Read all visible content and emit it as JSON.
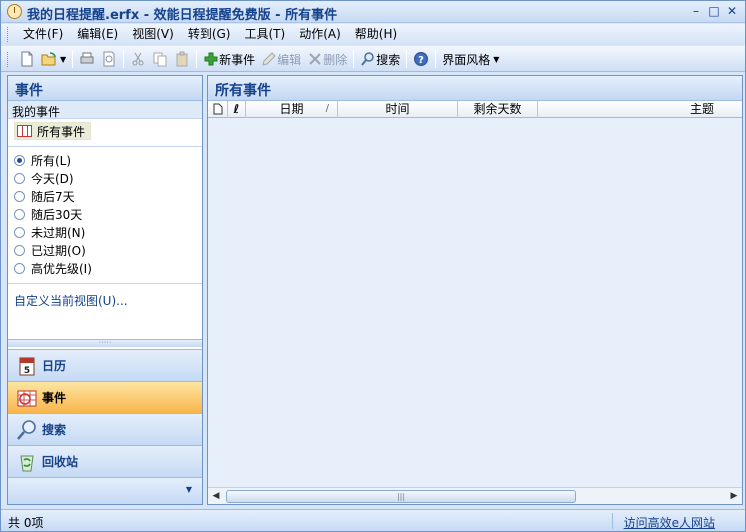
{
  "window": {
    "title": "我的日程提醒.erfx - 效能日程提醒免费版 - 所有事件",
    "controls": [
      "–",
      "□",
      "✕"
    ]
  },
  "menu": [
    "文件(F)",
    "编辑(E)",
    "视图(V)",
    "转到(G)",
    "工具(T)",
    "动作(A)",
    "帮助(H)"
  ],
  "toolbar": {
    "new_event": "新事件",
    "edit": "编辑",
    "delete": "删除",
    "search": "搜索",
    "ui_style": "界面风格"
  },
  "left_pane": {
    "title": "事件",
    "my_events": "我的事件",
    "all_events_view": "所有事件",
    "filters": [
      {
        "label": "所有(L)",
        "selected": true
      },
      {
        "label": "今天(D)",
        "selected": false
      },
      {
        "label": "随后7天",
        "selected": false
      },
      {
        "label": "随后30天",
        "selected": false
      },
      {
        "label": "未过期(N)",
        "selected": false
      },
      {
        "label": "已过期(O)",
        "selected": false
      },
      {
        "label": "高优先级(I)",
        "selected": false
      }
    ],
    "customize_link": "自定义当前视图(U)...",
    "nav": [
      {
        "label": "日历",
        "icon": "calendar-icon",
        "active": false,
        "badge": "5"
      },
      {
        "label": "事件",
        "icon": "event-icon",
        "active": true
      },
      {
        "label": "搜索",
        "icon": "search-icon",
        "active": false
      },
      {
        "label": "回收站",
        "icon": "recycle-bin-icon",
        "active": false
      }
    ]
  },
  "right_pane": {
    "title": "所有事件",
    "columns": [
      "日期",
      "时间",
      "剩余天数",
      "主题"
    ]
  },
  "status": {
    "count": "共 0项",
    "link": "访问高效e人网站"
  },
  "colors": {
    "accent": "#15428b",
    "active_nav": "#f9b54b"
  }
}
